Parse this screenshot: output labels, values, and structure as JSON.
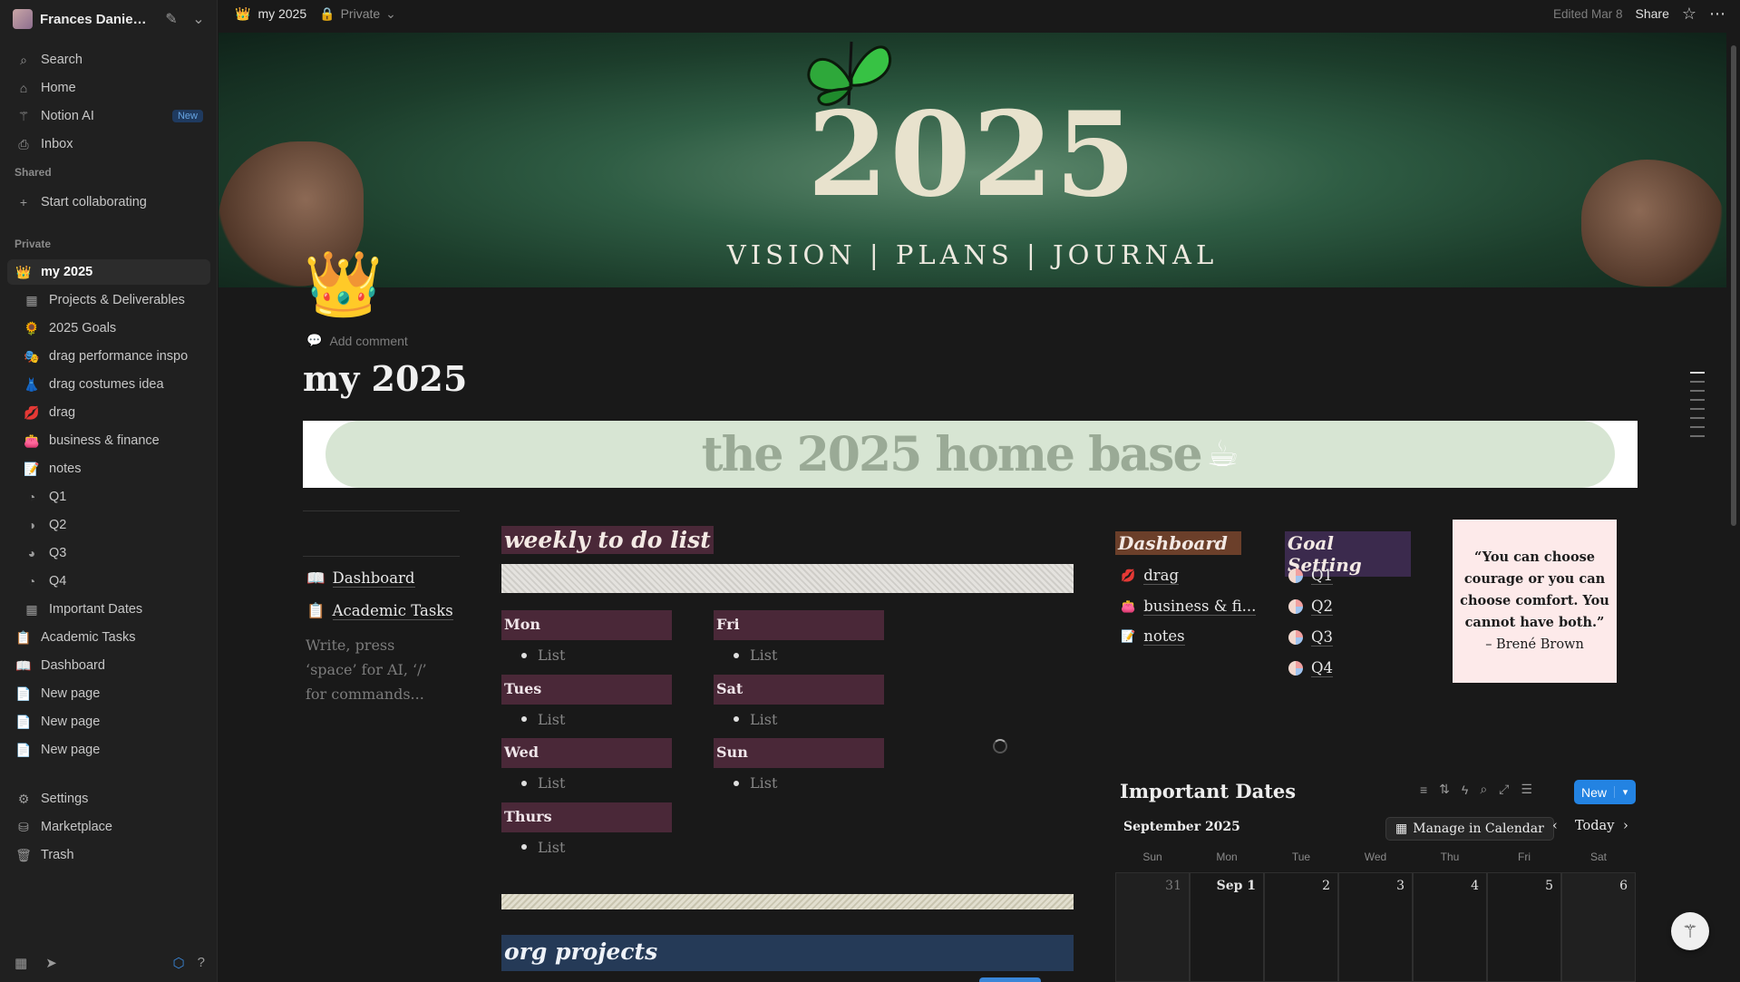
{
  "workspace": {
    "name": "Frances Daniel's ..."
  },
  "sidebar": {
    "top": [
      {
        "label": "Search",
        "icon": "search-icon"
      },
      {
        "label": "Home",
        "icon": "home-icon"
      },
      {
        "label": "Notion AI",
        "icon": "notion-ai-icon",
        "badge": "New"
      },
      {
        "label": "Inbox",
        "icon": "inbox-icon"
      }
    ],
    "shared_label": "Shared",
    "start_collab": "Start collaborating",
    "private_label": "Private",
    "pages": [
      {
        "label": "my 2025",
        "icon": "👑",
        "active": true,
        "sub": false
      },
      {
        "label": "Projects & Deliverables",
        "icon": "▦",
        "sub": true
      },
      {
        "label": "2025 Goals",
        "icon": "🌻",
        "sub": true
      },
      {
        "label": "drag performance inspo",
        "icon": "🎭",
        "sub": true
      },
      {
        "label": "drag costumes idea",
        "icon": "👗",
        "sub": true
      },
      {
        "label": "drag",
        "icon": "💋",
        "sub": true
      },
      {
        "label": "business & finance",
        "icon": "👛",
        "sub": true
      },
      {
        "label": "notes",
        "icon": "📝",
        "sub": true
      },
      {
        "label": "Q1",
        "icon": "◔",
        "sub": true
      },
      {
        "label": "Q2",
        "icon": "◑",
        "sub": true
      },
      {
        "label": "Q3",
        "icon": "◕",
        "sub": true
      },
      {
        "label": "Q4",
        "icon": "◔",
        "sub": true
      },
      {
        "label": "Important Dates",
        "icon": "▦",
        "sub": true
      },
      {
        "label": "Academic Tasks",
        "icon": "📋",
        "sub": false
      },
      {
        "label": "Dashboard",
        "icon": "📖",
        "sub": false
      },
      {
        "label": "New page",
        "icon": "📄",
        "sub": false
      },
      {
        "label": "New page",
        "icon": "📄",
        "sub": false
      },
      {
        "label": "New page",
        "icon": "📄",
        "sub": false
      }
    ],
    "bottom": [
      {
        "label": "Settings",
        "icon": "gear-icon"
      },
      {
        "label": "Marketplace",
        "icon": "marketplace-icon"
      },
      {
        "label": "Trash",
        "icon": "trash-icon"
      }
    ]
  },
  "topbar": {
    "page": "my 2025",
    "privacy": "Private",
    "edited": "Edited Mar 8",
    "share": "Share"
  },
  "cover": {
    "year": "2025",
    "subtitle": "VISION | PLANS | JOURNAL"
  },
  "page": {
    "add_comment": "Add comment",
    "title": "my 2025",
    "banner": "the 2025 home base",
    "links": [
      "Dashboard",
      "Academic Tasks"
    ],
    "placeholder": "Write, press ‘space’ for AI, ‘/’ for commands..."
  },
  "weekly": {
    "title": "weekly to do list",
    "days_left": [
      "Mon",
      "Tues",
      "Wed",
      "Thurs"
    ],
    "days_right": [
      "Fri",
      "Sat",
      "Sun"
    ],
    "item": "List"
  },
  "org": {
    "title": "org projects"
  },
  "dashboard": {
    "title": "Dashboard",
    "items": [
      "drag",
      "business & fi...",
      "notes"
    ]
  },
  "goals": {
    "title": "Goal Setting",
    "items": [
      "Q1",
      "Q2",
      "Q3",
      "Q4"
    ]
  },
  "quote": {
    "text": "“You can choose courage or you can choose comfort. You cannot have both.”",
    "author": "– Brené Brown"
  },
  "important_dates": {
    "title": "Important Dates",
    "new_label": "New",
    "month": "September 2025",
    "manage": "Manage in Calendar",
    "today": "Today",
    "weekdays": [
      "Sun",
      "Mon",
      "Tue",
      "Wed",
      "Thu",
      "Fri",
      "Sat"
    ],
    "days": [
      "31",
      "Sep 1",
      "2",
      "3",
      "4",
      "5",
      "6"
    ]
  },
  "colors": {
    "accent": "#2383e2",
    "day_header": "#4a2838",
    "org_header": "#253a57",
    "dashboard_tag": "#6b3f2a",
    "goals_tag": "#3b2a4d"
  }
}
